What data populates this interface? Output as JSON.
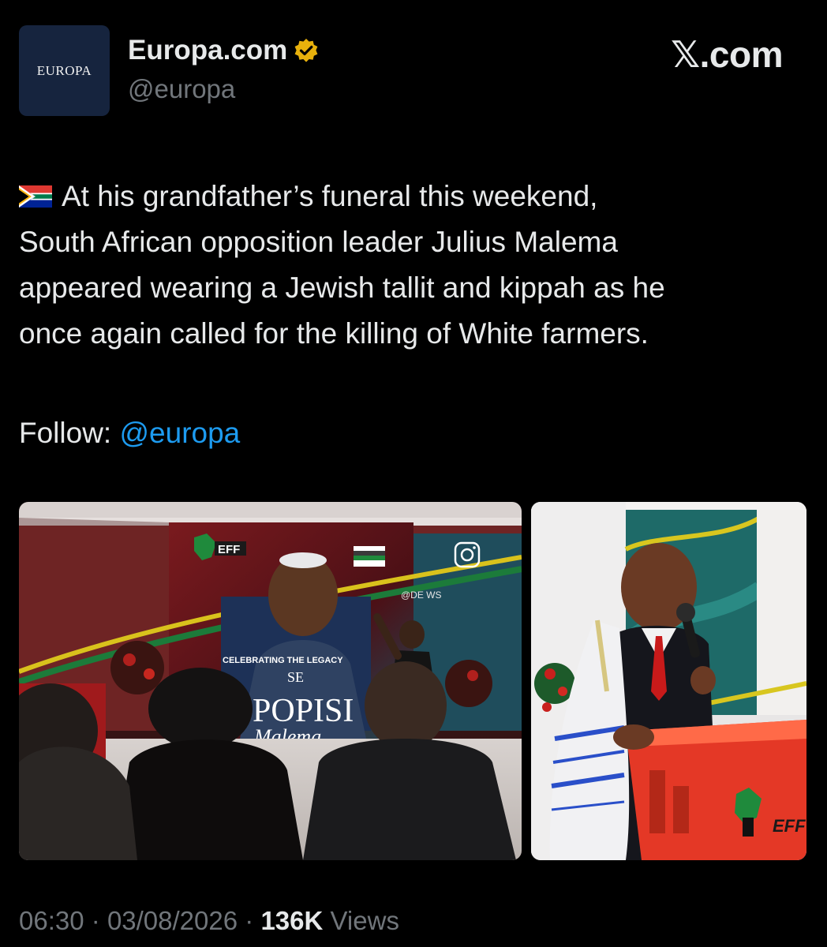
{
  "account": {
    "avatar_text": "EUROPA",
    "display_name": "Europa.com",
    "handle": "@europa",
    "verified_icon": "gold-verified-badge",
    "verified_color": "#f4b400"
  },
  "brand": {
    "label": "𝕏.com"
  },
  "tweet": {
    "flag_icon": "south-africa-flag",
    "lines": [
      "At his grandfather’s funeral this weekend,",
      "South African opposition leader Julius Malema",
      "appeared wearing a Jewish tallit and kippah as he",
      "once again called for the killing of White farmers."
    ],
    "follow_label": "Follow: ",
    "follow_link": "@europa",
    "link_color": "#1d9bf0"
  },
  "media": {
    "left_photo": {
      "banner_line1": "CELEBRATING THE LEGACY",
      "banner_line2": "SE",
      "banner_line3": "POPISI",
      "banner_line4": "Malema",
      "logo_text": "EFF",
      "watermark": "@DE    WS"
    },
    "right_photo": {
      "podium_text": "EFF"
    }
  },
  "footer": {
    "time": "06:30",
    "separator": "·",
    "date": "03/08/2026",
    "views_count": "136K",
    "views_label": "Views"
  }
}
